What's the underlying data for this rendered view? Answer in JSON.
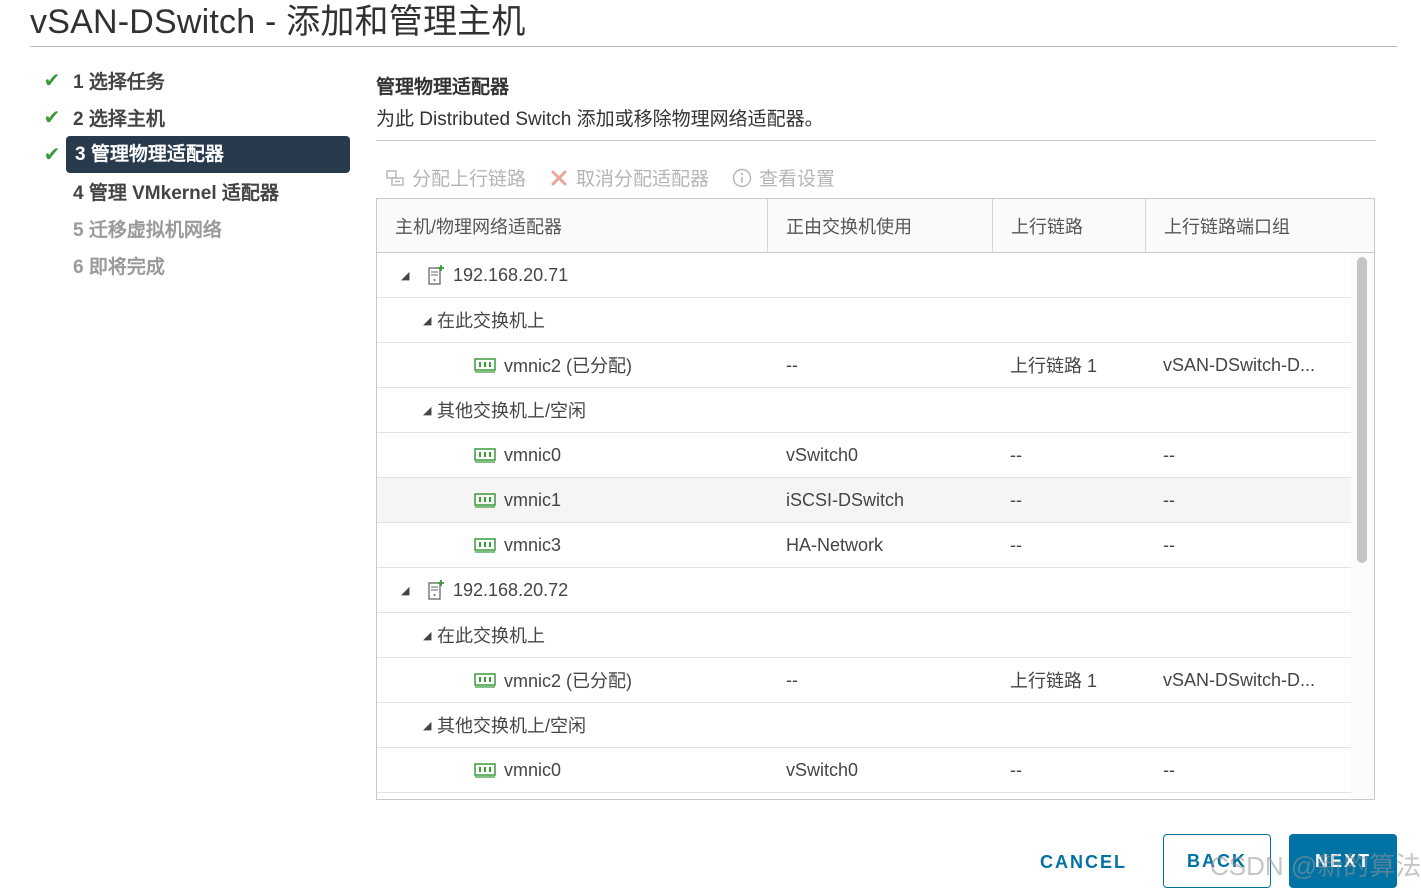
{
  "dialog": {
    "title": "vSAN-DSwitch - 添加和管理主机"
  },
  "steps": [
    {
      "label": "1 选择任务",
      "done": true
    },
    {
      "label": "2 选择主机",
      "done": true
    },
    {
      "label": "3 管理物理适配器",
      "done": true,
      "active": true
    },
    {
      "label": "4 管理 VMkernel 适配器"
    },
    {
      "label": "5 迁移虚拟机网络",
      "disabled": true
    },
    {
      "label": "6 即将完成",
      "disabled": true
    }
  ],
  "panel": {
    "title": "管理物理适配器",
    "description": "为此 Distributed Switch 添加或移除物理网络适配器。"
  },
  "toolbar": {
    "assign_uplink": "分配上行链路",
    "unassign_adapter": "取消分配适配器",
    "view_settings": "查看设置"
  },
  "grid": {
    "columns": [
      "主机/物理网络适配器",
      "正由交换机使用",
      "上行链路",
      "上行链路端口组"
    ],
    "rows": [
      {
        "name": "192.168.20.71"
      },
      {
        "name": "在此交换机上"
      },
      {
        "name": "vmnic2 (已分配)",
        "switch": "--",
        "uplink": "上行链路 1",
        "portgroup": "vSAN-DSwitch-D..."
      },
      {
        "name": "其他交换机上/空闲"
      },
      {
        "name": "vmnic0",
        "switch": "vSwitch0",
        "uplink": "--",
        "portgroup": "--"
      },
      {
        "name": "vmnic1",
        "switch": "iSCSI-DSwitch",
        "uplink": "--",
        "portgroup": "--"
      },
      {
        "name": "vmnic3",
        "switch": "HA-Network",
        "uplink": "--",
        "portgroup": "--"
      },
      {
        "name": "192.168.20.72"
      },
      {
        "name": "在此交换机上"
      },
      {
        "name": "vmnic2 (已分配)",
        "switch": "--",
        "uplink": "上行链路 1",
        "portgroup": "vSAN-DSwitch-D..."
      },
      {
        "name": "其他交换机上/空闲"
      },
      {
        "name": "vmnic0",
        "switch": "vSwitch0",
        "uplink": "--",
        "portgroup": "--"
      }
    ]
  },
  "footer": {
    "cancel": "CANCEL",
    "back": "BACK",
    "next": "NEXT"
  },
  "watermark": "CSDN @新的算法",
  "colors": {
    "accent": "#0072a3",
    "active_step_bg": "#273b4d",
    "check": "#3c9a3c",
    "nic_icon": "#3c9a3c"
  },
  "icons": {
    "step_done": "checkmark-icon",
    "host": "host-server-icon",
    "nic": "network-adapter-icon",
    "tree": "collapse-caret-icon"
  }
}
